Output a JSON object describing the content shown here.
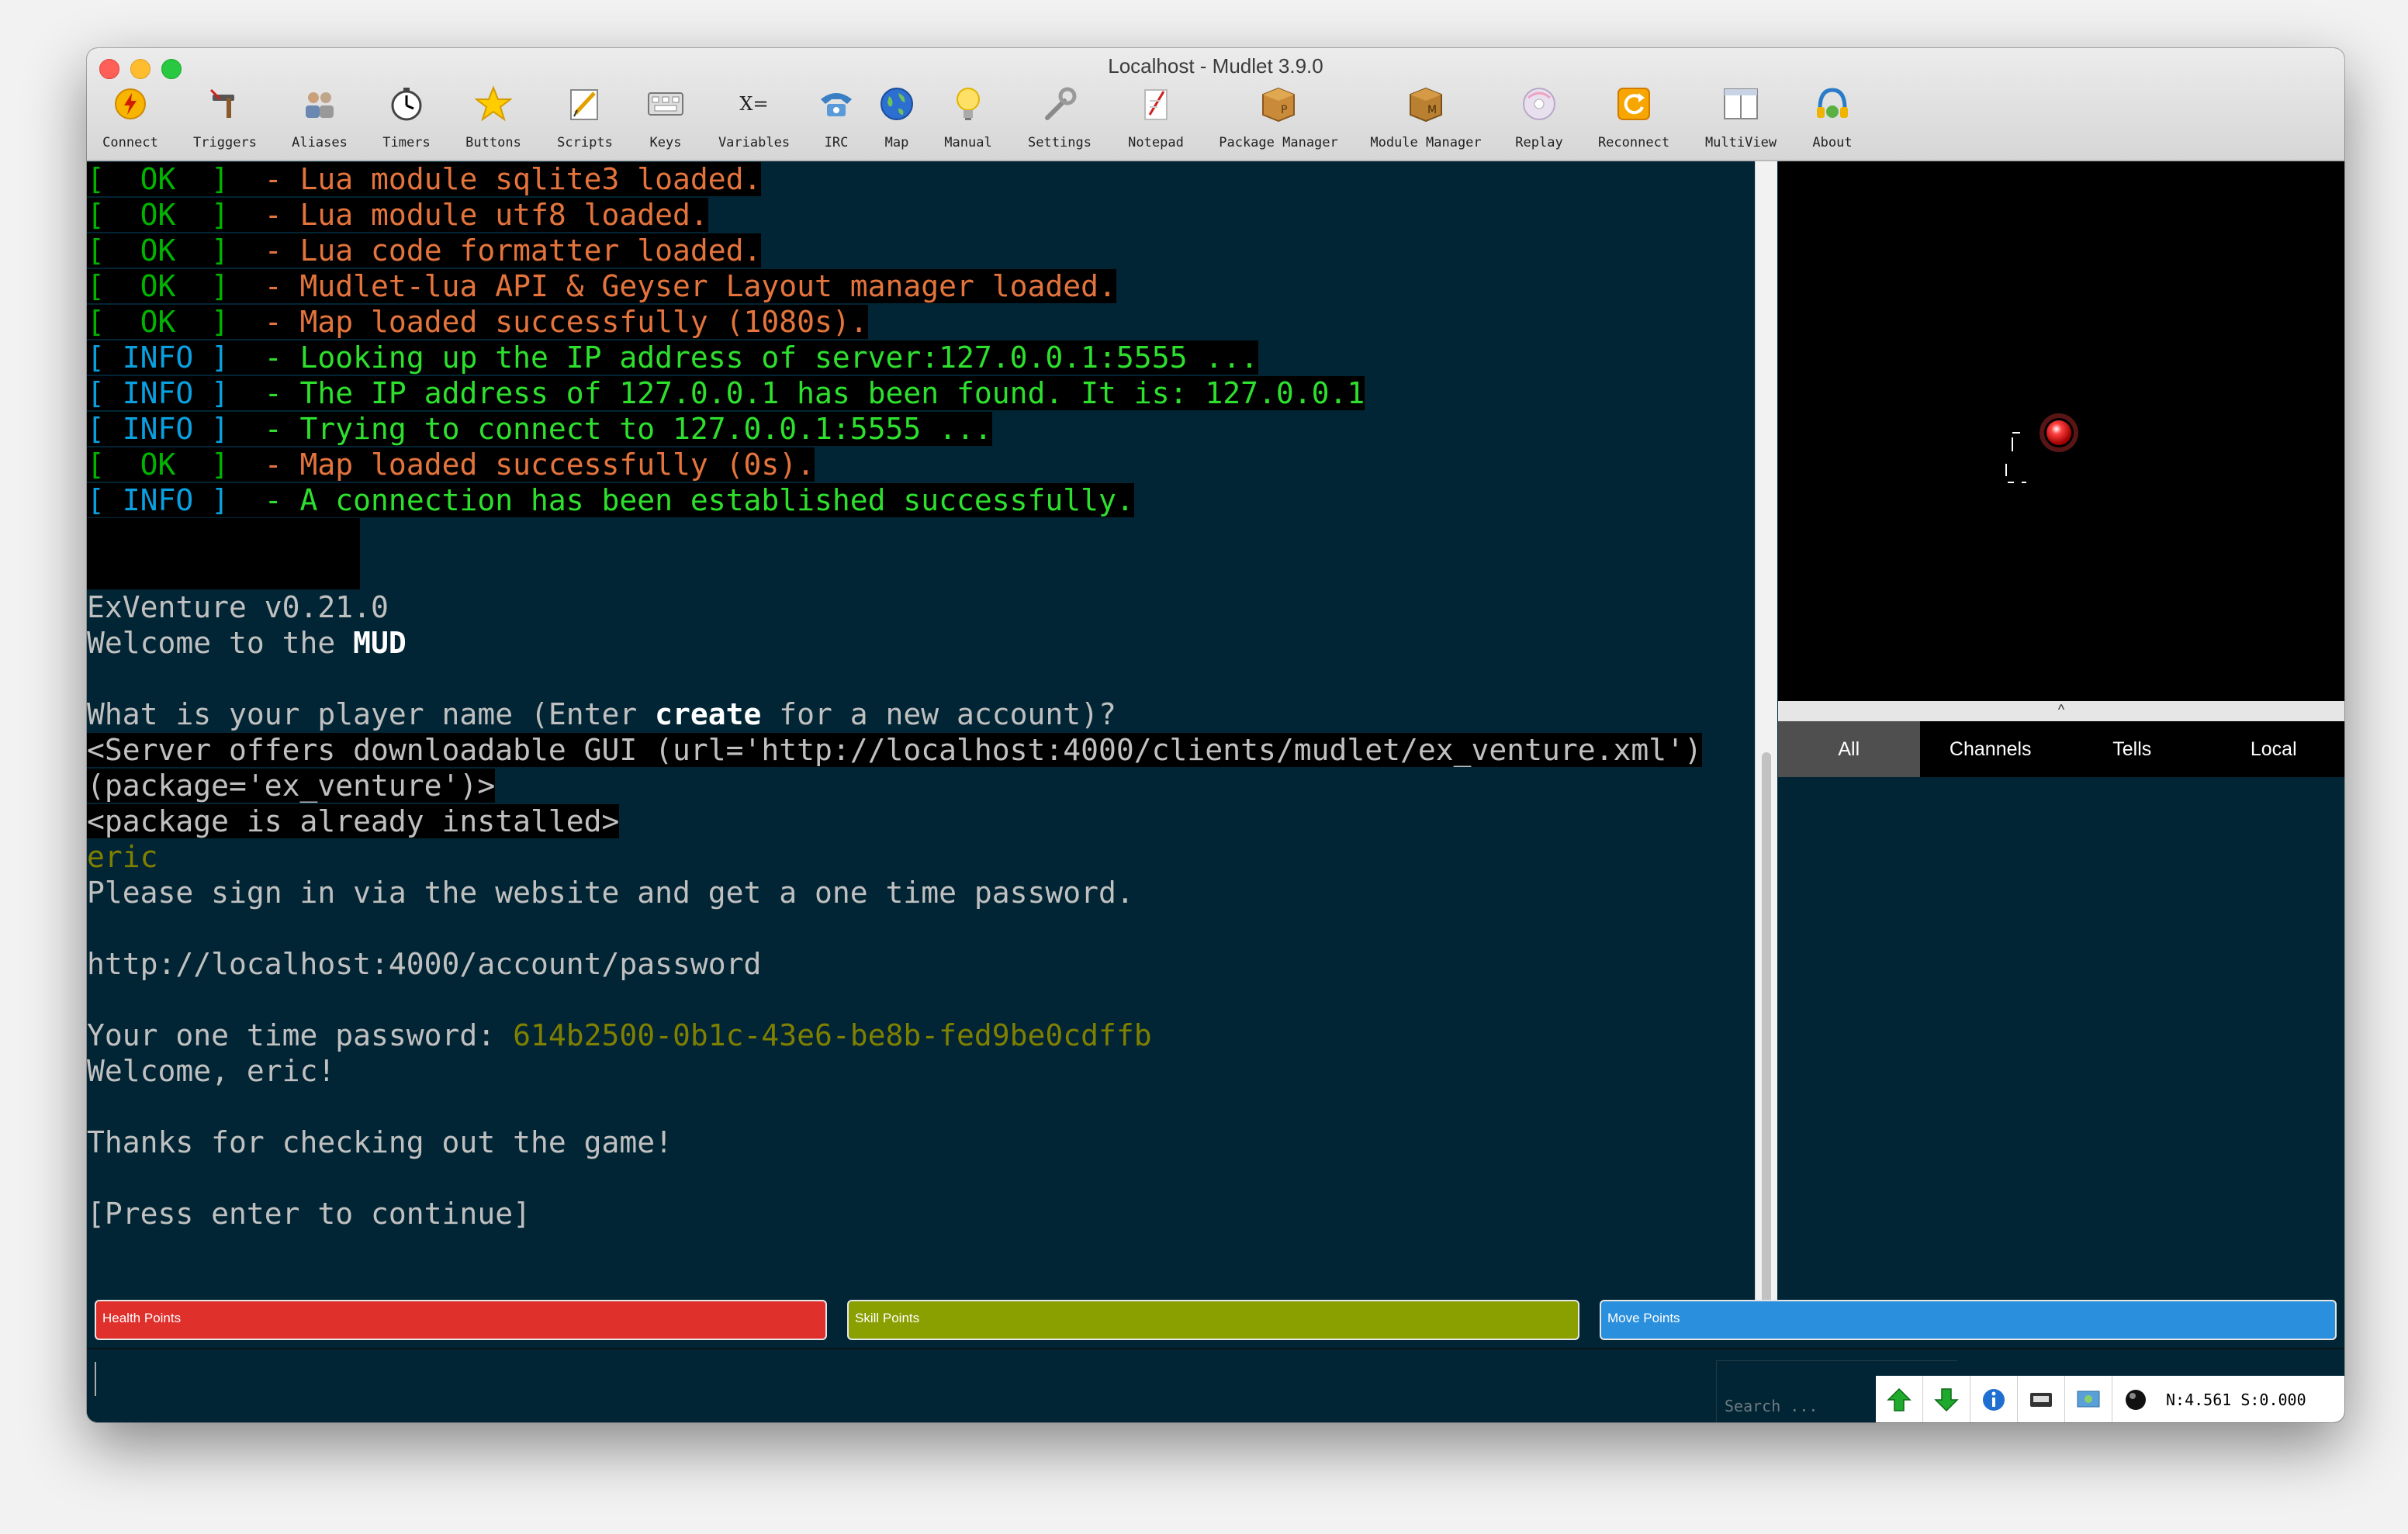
{
  "window": {
    "title": "Localhost - Mudlet 3.9.0"
  },
  "toolbar": {
    "items": [
      {
        "label": "Connect",
        "icon": "connect-icon"
      },
      {
        "label": "Triggers",
        "icon": "triggers-icon"
      },
      {
        "label": "Aliases",
        "icon": "aliases-icon"
      },
      {
        "label": "Timers",
        "icon": "timers-icon"
      },
      {
        "label": "Buttons",
        "icon": "buttons-icon"
      },
      {
        "label": "Scripts",
        "icon": "scripts-icon"
      },
      {
        "label": "Keys",
        "icon": "keys-icon"
      },
      {
        "label": "Variables",
        "icon": "variables-icon"
      },
      {
        "label": "IRC",
        "icon": "irc-icon"
      },
      {
        "label": "Map",
        "icon": "map-icon"
      },
      {
        "label": "Manual",
        "icon": "manual-icon"
      },
      {
        "label": "Settings",
        "icon": "settings-icon"
      },
      {
        "label": "Notepad",
        "icon": "notepad-icon"
      },
      {
        "label": "Package Manager",
        "icon": "package-manager-icon"
      },
      {
        "label": "Module Manager",
        "icon": "module-manager-icon"
      },
      {
        "label": "Replay",
        "icon": "replay-icon"
      },
      {
        "label": "Reconnect",
        "icon": "reconnect-icon"
      },
      {
        "label": "MultiView",
        "icon": "multiview-icon"
      },
      {
        "label": "About",
        "icon": "about-icon"
      }
    ],
    "variables_glyph": "X="
  },
  "console": {
    "lines": [
      {
        "text": "[  OK  ]  - Lua module sqlite3 loaded."
      },
      {
        "text": "[  OK  ]  - Lua module utf8 loaded."
      },
      {
        "text": "[  OK  ]  - Lua code formatter loaded."
      },
      {
        "text": "[  OK  ]  - Mudlet-lua API & Geyser Layout manager loaded."
      },
      {
        "text": "[  OK  ]  - Map loaded successfully (1080s)."
      },
      {
        "text": "[ INFO ]  - Looking up the IP address of server:127.0.0.1:5555 ..."
      },
      {
        "text": "[ INFO ]  - The IP address of 127.0.0.1 has been found. It is: 127.0.0.1"
      },
      {
        "text": "[ INFO ]  - Trying to connect to 127.0.0.1:5555 ..."
      },
      {
        "text": "[  OK  ]  - Map loaded successfully (0s)."
      },
      {
        "text": "[ INFO ]  - A connection has been established successfully."
      },
      {
        "text": ""
      },
      {
        "text": ""
      },
      {
        "text": "ExVenture v0.21.0"
      },
      {
        "text": "Welcome to the MUD"
      },
      {
        "text": ""
      },
      {
        "text": "What is your player name (Enter create for a new account)?"
      },
      {
        "text": "<Server offers downloadable GUI (url='http://localhost:4000/clients/mudlet/ex_venture.xml')"
      },
      {
        "text": "(package='ex_venture')>"
      },
      {
        "text": "<package is already installed>"
      },
      {
        "text": "eric"
      },
      {
        "text": "Please sign in via the website and get a one time password."
      },
      {
        "text": ""
      },
      {
        "text": "http://localhost:4000/account/password"
      },
      {
        "text": ""
      },
      {
        "text": "Your one time password: 614b2500-0b1c-43e6-be8b-fed9be0cdffb"
      },
      {
        "text": "Welcome, eric!"
      },
      {
        "text": ""
      },
      {
        "text": "Thanks for checking out the game!"
      },
      {
        "text": ""
      },
      {
        "text": "[Press enter to continue]"
      }
    ],
    "segments": {
      "ok_tag": "[  OK  ]",
      "info_tag": "[ INFO ]",
      "dash": "  - ",
      "bold_create": "create",
      "bold_mud": "MUD",
      "password": "614b2500-0b1c-43e6-be8b-fed9be0cdffb"
    }
  },
  "map": {
    "expand_glyph": "^"
  },
  "tabs": [
    {
      "label": "All",
      "active": true
    },
    {
      "label": "Channels",
      "active": false
    },
    {
      "label": "Tells",
      "active": false
    },
    {
      "label": "Local",
      "active": false
    }
  ],
  "gauges": [
    {
      "label": "Health Points",
      "color": "#e0302c"
    },
    {
      "label": "Skill Points",
      "color": "#8aa000"
    },
    {
      "label": "Move Points",
      "color": "#2a8fdc"
    }
  ],
  "command_line": {
    "search_placeholder": "Search ...",
    "stats": "N:4.561 S:0.000",
    "buttons": [
      "scroll-up-icon",
      "scroll-down-icon",
      "info-icon",
      "timestamp-icon",
      "network-icon",
      "record-icon"
    ]
  },
  "colors": {
    "console_bg": "#012534",
    "ok_green": "#00b400",
    "info_blue": "#0aa0e0",
    "orange": "#e4743c",
    "bright_green": "#2ee02e",
    "text": "#c0c0c0",
    "olive": "#7f7f00"
  }
}
